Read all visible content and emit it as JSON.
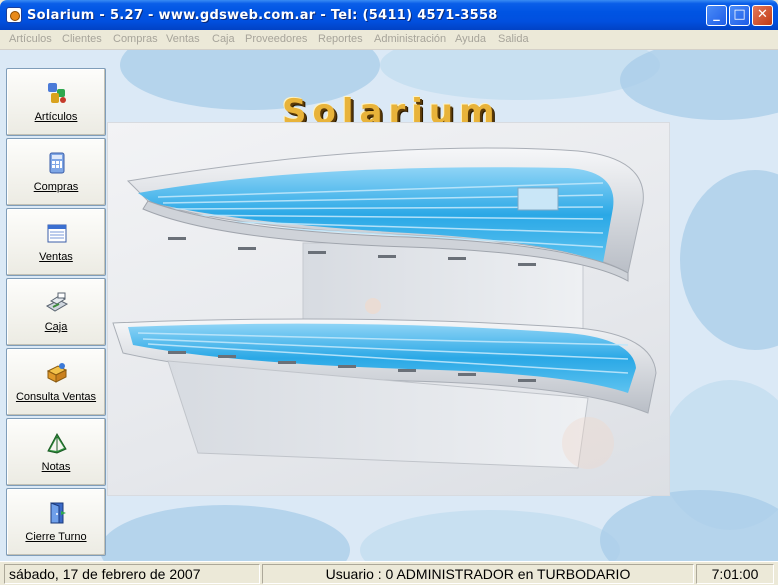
{
  "window": {
    "title": "Solarium -  5.27 - www.gdsweb.com.ar - Tel: (5411) 4571-3558",
    "minimize": "_",
    "maximize": "□",
    "close": "✕"
  },
  "menu": [
    "Artículos",
    "Clientes",
    "Compras",
    "Ventas",
    "Caja",
    "Proveedores",
    "Reportes",
    "Administración",
    "Ayuda",
    "Salida"
  ],
  "nav": [
    {
      "label": "Artículos",
      "icon": "articles-icon"
    },
    {
      "label": "Compras",
      "icon": "calculator-icon"
    },
    {
      "label": "Ventas",
      "icon": "calendar-icon"
    },
    {
      "label": "Caja",
      "icon": "cash-register-icon"
    },
    {
      "label": "Consulta  Ventas",
      "icon": "sales-query-icon"
    },
    {
      "label": "Notas",
      "icon": "notebook-icon"
    },
    {
      "label": "Cierre Turno",
      "icon": "door-exit-icon"
    }
  ],
  "hero": {
    "title": "Solarium",
    "title_color": "#e8b33a"
  },
  "status": {
    "date": "sábado, 17 de febrero de 2007",
    "user": "Usuario : 0 ADMINISTRADOR en TURBODARIO",
    "time": "7:01:00"
  },
  "colors": {
    "titlebar": "#0054e3",
    "background_wave": "#a8cce8",
    "tanning_light": "#2aa8e6"
  }
}
